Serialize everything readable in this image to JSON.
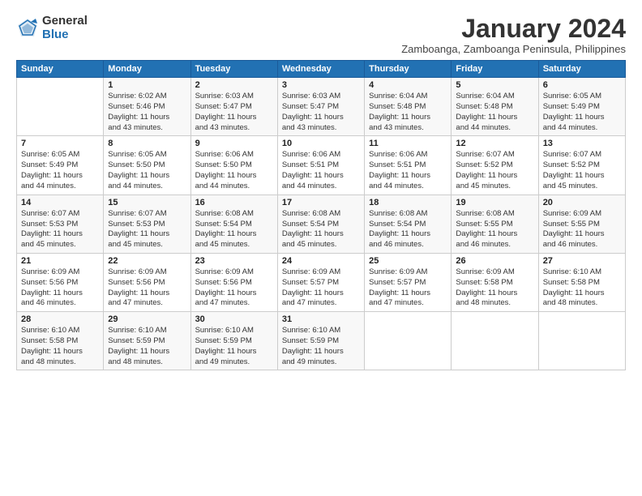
{
  "logo": {
    "general": "General",
    "blue": "Blue"
  },
  "title": "January 2024",
  "subtitle": "Zamboanga, Zamboanga Peninsula, Philippines",
  "days_header": [
    "Sunday",
    "Monday",
    "Tuesday",
    "Wednesday",
    "Thursday",
    "Friday",
    "Saturday"
  ],
  "weeks": [
    [
      {
        "day": "",
        "info": ""
      },
      {
        "day": "1",
        "info": "Sunrise: 6:02 AM\nSunset: 5:46 PM\nDaylight: 11 hours\nand 43 minutes."
      },
      {
        "day": "2",
        "info": "Sunrise: 6:03 AM\nSunset: 5:47 PM\nDaylight: 11 hours\nand 43 minutes."
      },
      {
        "day": "3",
        "info": "Sunrise: 6:03 AM\nSunset: 5:47 PM\nDaylight: 11 hours\nand 43 minutes."
      },
      {
        "day": "4",
        "info": "Sunrise: 6:04 AM\nSunset: 5:48 PM\nDaylight: 11 hours\nand 43 minutes."
      },
      {
        "day": "5",
        "info": "Sunrise: 6:04 AM\nSunset: 5:48 PM\nDaylight: 11 hours\nand 44 minutes."
      },
      {
        "day": "6",
        "info": "Sunrise: 6:05 AM\nSunset: 5:49 PM\nDaylight: 11 hours\nand 44 minutes."
      }
    ],
    [
      {
        "day": "7",
        "info": "Sunrise: 6:05 AM\nSunset: 5:49 PM\nDaylight: 11 hours\nand 44 minutes."
      },
      {
        "day": "8",
        "info": "Sunrise: 6:05 AM\nSunset: 5:50 PM\nDaylight: 11 hours\nand 44 minutes."
      },
      {
        "day": "9",
        "info": "Sunrise: 6:06 AM\nSunset: 5:50 PM\nDaylight: 11 hours\nand 44 minutes."
      },
      {
        "day": "10",
        "info": "Sunrise: 6:06 AM\nSunset: 5:51 PM\nDaylight: 11 hours\nand 44 minutes."
      },
      {
        "day": "11",
        "info": "Sunrise: 6:06 AM\nSunset: 5:51 PM\nDaylight: 11 hours\nand 44 minutes."
      },
      {
        "day": "12",
        "info": "Sunrise: 6:07 AM\nSunset: 5:52 PM\nDaylight: 11 hours\nand 45 minutes."
      },
      {
        "day": "13",
        "info": "Sunrise: 6:07 AM\nSunset: 5:52 PM\nDaylight: 11 hours\nand 45 minutes."
      }
    ],
    [
      {
        "day": "14",
        "info": "Sunrise: 6:07 AM\nSunset: 5:53 PM\nDaylight: 11 hours\nand 45 minutes."
      },
      {
        "day": "15",
        "info": "Sunrise: 6:07 AM\nSunset: 5:53 PM\nDaylight: 11 hours\nand 45 minutes."
      },
      {
        "day": "16",
        "info": "Sunrise: 6:08 AM\nSunset: 5:54 PM\nDaylight: 11 hours\nand 45 minutes."
      },
      {
        "day": "17",
        "info": "Sunrise: 6:08 AM\nSunset: 5:54 PM\nDaylight: 11 hours\nand 45 minutes."
      },
      {
        "day": "18",
        "info": "Sunrise: 6:08 AM\nSunset: 5:54 PM\nDaylight: 11 hours\nand 46 minutes."
      },
      {
        "day": "19",
        "info": "Sunrise: 6:08 AM\nSunset: 5:55 PM\nDaylight: 11 hours\nand 46 minutes."
      },
      {
        "day": "20",
        "info": "Sunrise: 6:09 AM\nSunset: 5:55 PM\nDaylight: 11 hours\nand 46 minutes."
      }
    ],
    [
      {
        "day": "21",
        "info": "Sunrise: 6:09 AM\nSunset: 5:56 PM\nDaylight: 11 hours\nand 46 minutes."
      },
      {
        "day": "22",
        "info": "Sunrise: 6:09 AM\nSunset: 5:56 PM\nDaylight: 11 hours\nand 47 minutes."
      },
      {
        "day": "23",
        "info": "Sunrise: 6:09 AM\nSunset: 5:56 PM\nDaylight: 11 hours\nand 47 minutes."
      },
      {
        "day": "24",
        "info": "Sunrise: 6:09 AM\nSunset: 5:57 PM\nDaylight: 11 hours\nand 47 minutes."
      },
      {
        "day": "25",
        "info": "Sunrise: 6:09 AM\nSunset: 5:57 PM\nDaylight: 11 hours\nand 47 minutes."
      },
      {
        "day": "26",
        "info": "Sunrise: 6:09 AM\nSunset: 5:58 PM\nDaylight: 11 hours\nand 48 minutes."
      },
      {
        "day": "27",
        "info": "Sunrise: 6:10 AM\nSunset: 5:58 PM\nDaylight: 11 hours\nand 48 minutes."
      }
    ],
    [
      {
        "day": "28",
        "info": "Sunrise: 6:10 AM\nSunset: 5:58 PM\nDaylight: 11 hours\nand 48 minutes."
      },
      {
        "day": "29",
        "info": "Sunrise: 6:10 AM\nSunset: 5:59 PM\nDaylight: 11 hours\nand 48 minutes."
      },
      {
        "day": "30",
        "info": "Sunrise: 6:10 AM\nSunset: 5:59 PM\nDaylight: 11 hours\nand 49 minutes."
      },
      {
        "day": "31",
        "info": "Sunrise: 6:10 AM\nSunset: 5:59 PM\nDaylight: 11 hours\nand 49 minutes."
      },
      {
        "day": "",
        "info": ""
      },
      {
        "day": "",
        "info": ""
      },
      {
        "day": "",
        "info": ""
      }
    ]
  ]
}
